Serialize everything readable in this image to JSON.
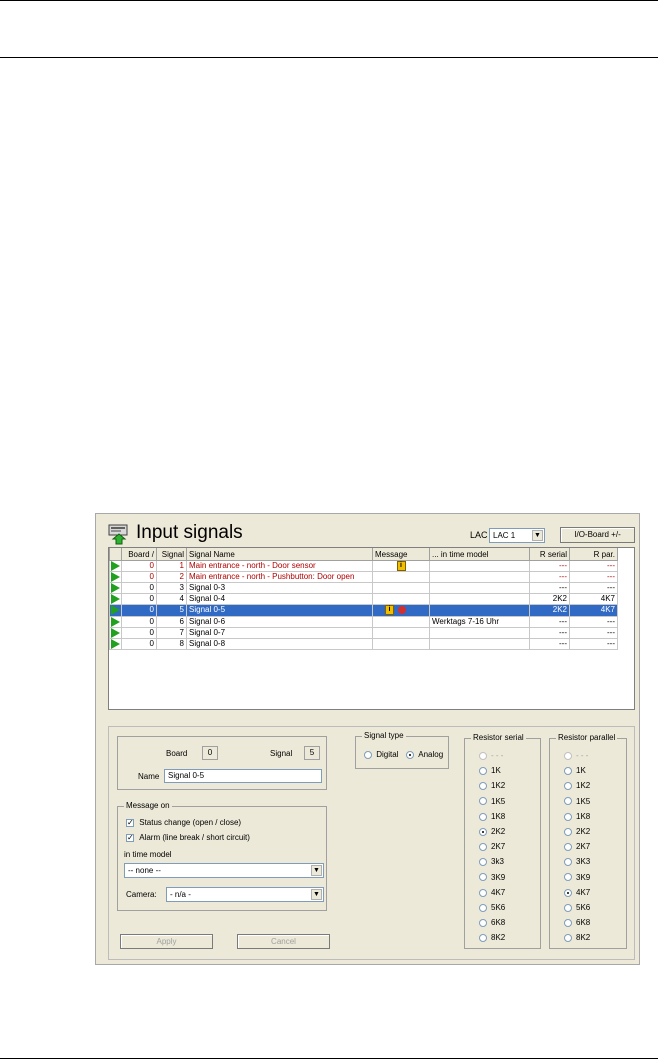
{
  "window": {
    "title": "Input signals",
    "lac_label": "LAC",
    "lac_value": "LAC 1",
    "io_board_button": "I/O-Board +/-"
  },
  "table": {
    "columns": [
      "Board /",
      "Signal",
      "Signal Name",
      "Message",
      "... in time model",
      "R serial",
      "R par."
    ],
    "rows": [
      {
        "board": "0",
        "signal": "1",
        "name": "Main entrance - north - Door sensor",
        "info": true,
        "alarm": false,
        "time_model": "",
        "r_serial": "---",
        "r_par": "---",
        "style": "red"
      },
      {
        "board": "0",
        "signal": "2",
        "name": "Main entrance - north - Pushbutton: Door open",
        "info": false,
        "alarm": false,
        "time_model": "",
        "r_serial": "---",
        "r_par": "---",
        "style": "red"
      },
      {
        "board": "0",
        "signal": "3",
        "name": "Signal 0-3",
        "info": false,
        "alarm": false,
        "time_model": "",
        "r_serial": "---",
        "r_par": "---",
        "style": "normal"
      },
      {
        "board": "0",
        "signal": "4",
        "name": "Signal 0-4",
        "info": false,
        "alarm": false,
        "time_model": "",
        "r_serial": "2K2",
        "r_par": "4K7",
        "style": "normal"
      },
      {
        "board": "0",
        "signal": "5",
        "name": "Signal 0-5",
        "info": true,
        "alarm": true,
        "time_model": "",
        "r_serial": "2K2",
        "r_par": "4K7",
        "style": "selected"
      },
      {
        "board": "0",
        "signal": "6",
        "name": "Signal 0-6",
        "info": false,
        "alarm": false,
        "time_model": "Werktags 7-16 Uhr",
        "r_serial": "---",
        "r_par": "---",
        "style": "normal"
      },
      {
        "board": "0",
        "signal": "7",
        "name": "Signal 0-7",
        "info": false,
        "alarm": false,
        "time_model": "",
        "r_serial": "---",
        "r_par": "---",
        "style": "normal"
      },
      {
        "board": "0",
        "signal": "8",
        "name": "Signal 0-8",
        "info": false,
        "alarm": false,
        "time_model": "",
        "r_serial": "---",
        "r_par": "---",
        "style": "normal"
      }
    ]
  },
  "details": {
    "board_label": "Board",
    "board_value": "0",
    "signal_label": "Signal",
    "signal_value": "5",
    "name_label": "Name",
    "name_value": "Signal 0-5"
  },
  "message_on": {
    "legend": "Message on",
    "status_change": "Status change (open / close)",
    "alarm": "Alarm (line break / short circuit)",
    "time_model_label": "in time model",
    "time_model_value": "-- none --",
    "camera_label": "Camera:",
    "camera_value": "- n/a -"
  },
  "signal_type": {
    "legend": "Signal type",
    "digital": "Digital",
    "analog": "Analog",
    "selected": "analog"
  },
  "resistor_serial": {
    "legend": "Resistor serial",
    "options": [
      "- - -",
      "1K",
      "1K2",
      "1K5",
      "1K8",
      "2K2",
      "2K7",
      "3k3",
      "3K9",
      "4K7",
      "5K6",
      "6K8",
      "8K2"
    ],
    "selected": "2K2"
  },
  "resistor_parallel": {
    "legend": "Resistor parallel",
    "options": [
      "- - -",
      "1K",
      "1K2",
      "1K5",
      "1K8",
      "2K2",
      "2K7",
      "3K3",
      "3K9",
      "4K7",
      "5K6",
      "6K8",
      "8K2"
    ],
    "selected": "4K7"
  },
  "buttons": {
    "apply": "Apply",
    "cancel": "Cancel"
  },
  "colors": {
    "selection": "#316ac5",
    "error_text": "#b00000",
    "arrow": "#22a020"
  },
  "icons": [
    "input-signals-icon",
    "row-arrow-icon",
    "info-icon",
    "alarm-icon",
    "chevron-down-icon"
  ]
}
